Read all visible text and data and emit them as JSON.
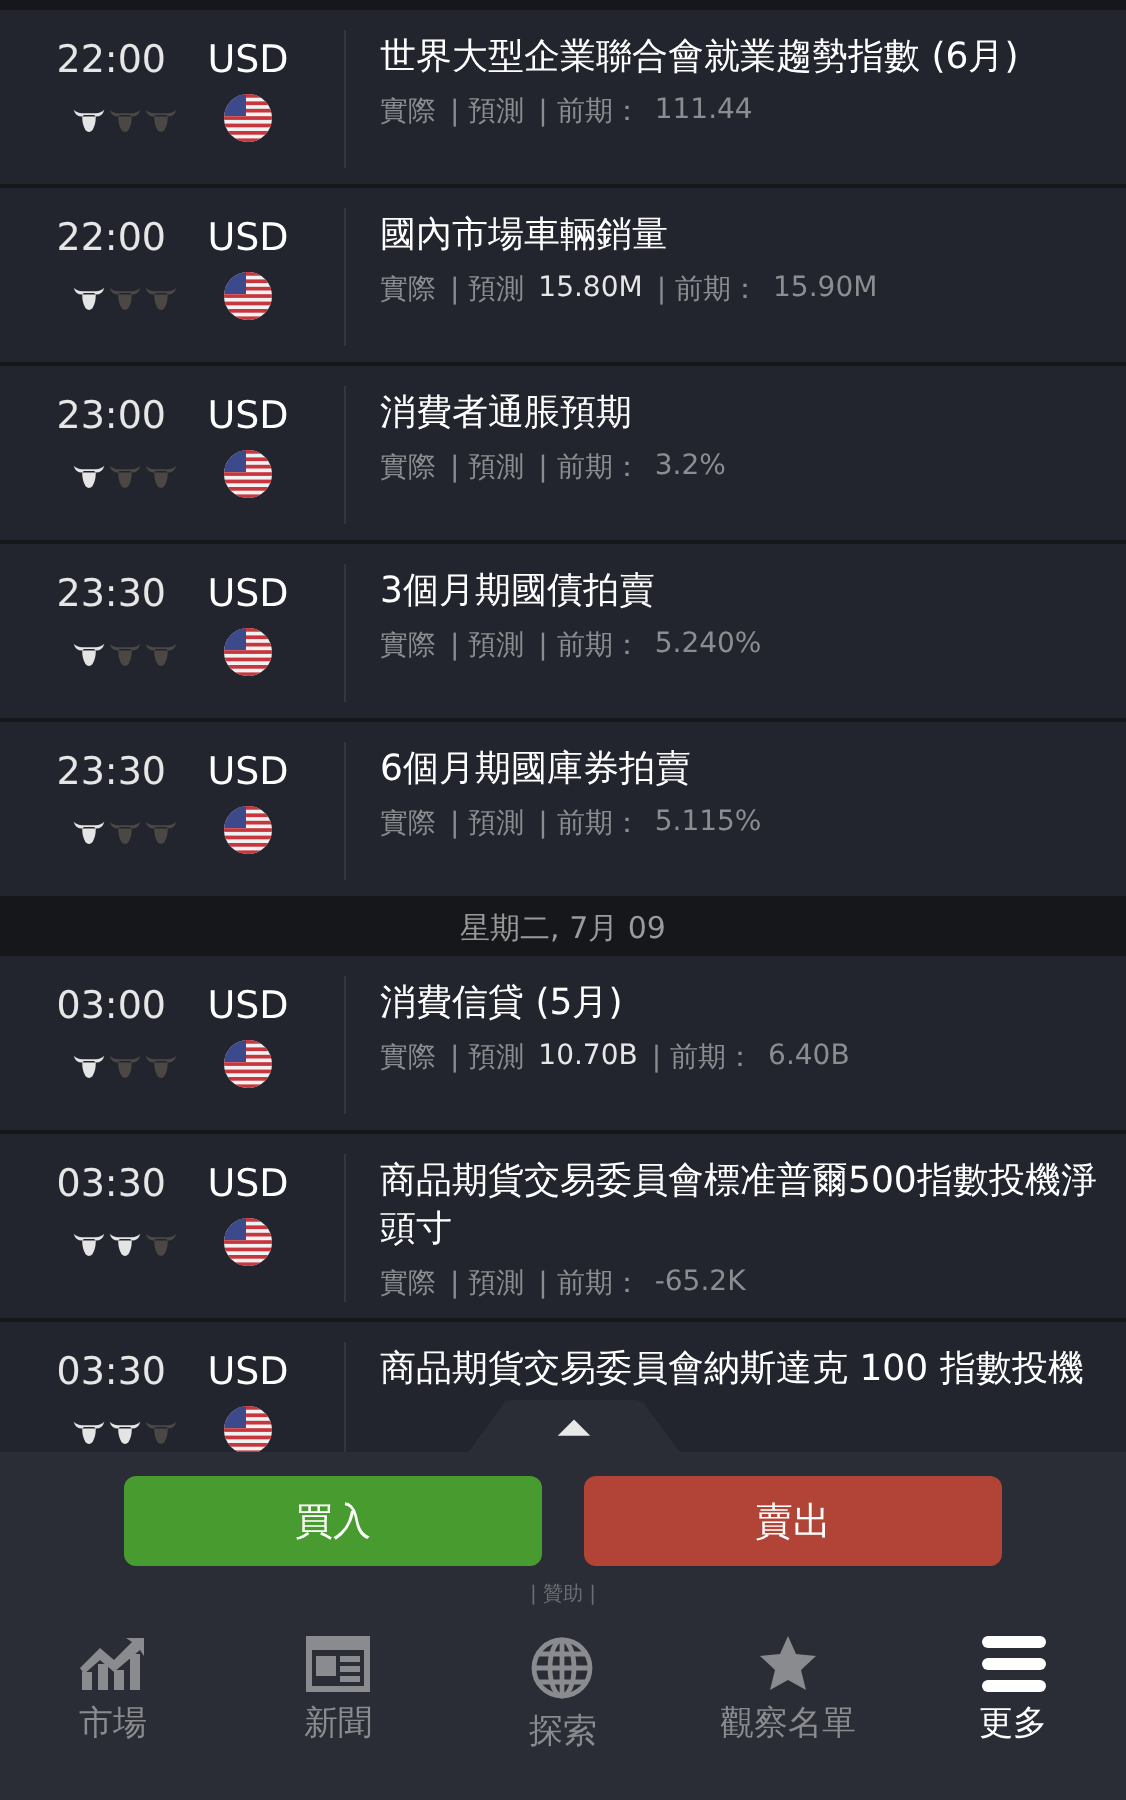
{
  "calendar": [
    {
      "kind": "event",
      "time": "22:00",
      "currency": "USD",
      "stars": 1,
      "title": "世界大型企業聯合會就業趨勢指數 (6月)",
      "actual": "實際",
      "forecast": "| 預測",
      "previous": "| 前期：",
      "previous_value": "111.44"
    },
    {
      "kind": "event",
      "time": "22:00",
      "currency": "USD",
      "stars": 1,
      "title": "國內市場車輛銷量",
      "actual": "實際",
      "forecast": "| 預測",
      "forecast_value": "15.80M",
      "previous": "| 前期：",
      "previous_value": "15.90M"
    },
    {
      "kind": "event",
      "time": "23:00",
      "currency": "USD",
      "stars": 1,
      "title": "消費者通脹預期",
      "actual": "實際",
      "forecast": "| 預測",
      "previous": "| 前期：",
      "previous_value": "3.2%"
    },
    {
      "kind": "event",
      "time": "23:30",
      "currency": "USD",
      "stars": 1,
      "title": "3個月期國債拍賣",
      "actual": "實際",
      "forecast": "| 預測",
      "previous": "| 前期：",
      "previous_value": "5.240%"
    },
    {
      "kind": "event",
      "time": "23:30",
      "currency": "USD",
      "stars": 1,
      "title": "6個月期國庫券拍賣",
      "actual": "實際",
      "forecast": "| 預測",
      "previous": "| 前期：",
      "previous_value": "5.115%"
    },
    {
      "kind": "date",
      "label": "星期二, 7月 09"
    },
    {
      "kind": "event",
      "time": "03:00",
      "currency": "USD",
      "stars": 1,
      "title": "消費信貸 (5月)",
      "actual": "實際",
      "forecast": "| 預測",
      "forecast_value": "10.70B",
      "previous": "| 前期：",
      "previous_value": "6.40B"
    },
    {
      "kind": "event",
      "time": "03:30",
      "currency": "USD",
      "stars": 2,
      "title": "商品期貨交易委員會標准普爾500指數投機淨頭寸",
      "actual": "實際",
      "forecast": "| 預測",
      "previous": "| 前期：",
      "previous_value": "-65.2K"
    },
    {
      "kind": "event",
      "time": "03:30",
      "currency": "USD",
      "stars": 2,
      "title": "商品期貨交易委員會納斯達克 100 指數投機"
    }
  ],
  "trade_buttons": [
    {
      "label": "買入",
      "kind": "buy"
    },
    {
      "label": "賣出",
      "kind": "sell"
    }
  ],
  "sponsor": "| 贊助 |",
  "nav": [
    {
      "label": "市場",
      "selected": false
    },
    {
      "label": "新聞",
      "selected": false
    },
    {
      "label": "探索",
      "selected": false
    },
    {
      "label": "觀察名單",
      "selected": false
    },
    {
      "label": "更多",
      "selected": true
    }
  ]
}
